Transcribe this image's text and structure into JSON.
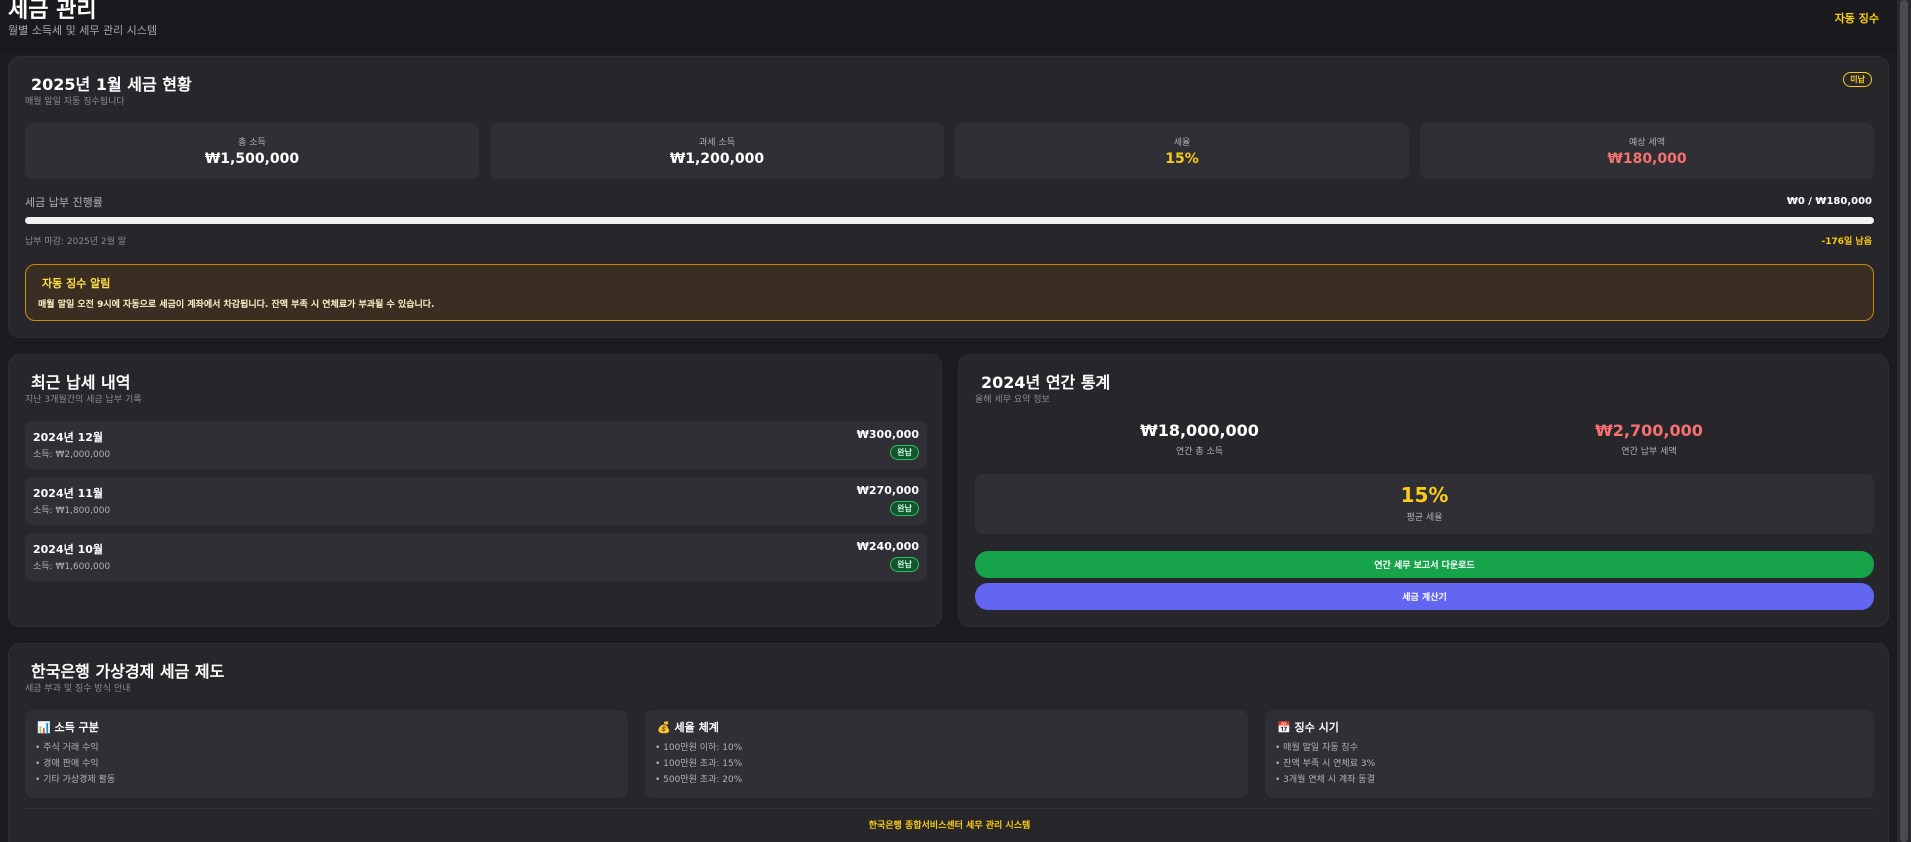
{
  "header": {
    "title": "세금 관리",
    "subtitle": "월별 소득세 및 세무 관리 시스템",
    "auto_link": "자동 징수"
  },
  "status": {
    "title": "2025년 1월 세금 현황",
    "subtitle": "매월 말일 자동 징수됩니다",
    "badge": "미납",
    "stats": [
      {
        "label": "총 소득",
        "value": "₩1,500,000",
        "color": "#ffffff"
      },
      {
        "label": "과세 소득",
        "value": "₩1,200,000",
        "color": "#ffffff"
      },
      {
        "label": "세율",
        "value": "15%",
        "color": "#facc15"
      },
      {
        "label": "예상 세액",
        "value": "₩180,000",
        "color": "#f87171"
      }
    ],
    "progress_label": "세금 납부 진행률",
    "progress_value": "₩0 / ₩180,000",
    "progress_fraction": 0,
    "deadline": "납부 마감: 2025년 2월 말",
    "overdue": "-176일 남음",
    "alert_title": "자동 징수 알림",
    "alert_text": "매월 말일 오전 9시에 자동으로 세금이 계좌에서 차감됩니다. 잔액 부족 시 연체료가 부과될 수 있습니다."
  },
  "recent": {
    "title": "최근 납세 내역",
    "subtitle": "지난 3개월간의 세금 납부 기록",
    "items": [
      {
        "month": "2024년 12월",
        "income": "소득: ₩2,000,000",
        "amount": "₩300,000",
        "status": "완납"
      },
      {
        "month": "2024년 11월",
        "income": "소득: ₩1,800,000",
        "amount": "₩270,000",
        "status": "완납"
      },
      {
        "month": "2024년 10월",
        "income": "소득: ₩1,600,000",
        "amount": "₩240,000",
        "status": "완납"
      }
    ]
  },
  "annual": {
    "title": "2024년 연간 통계",
    "subtitle": "올해 세무 요약 정보",
    "total_income_value": "₩18,000,000",
    "total_income_label": "연간 총 소득",
    "total_tax_value": "₩2,700,000",
    "total_tax_label": "연간 납부 세액",
    "avg_rate_value": "15%",
    "avg_rate_label": "평균 세율",
    "download_button": "연간 세무 보고서 다운로드",
    "calculator_button": "세금 계산기",
    "colors": {
      "income": "#ffffff",
      "tax": "#f87171",
      "rate": "#facc15"
    }
  },
  "system": {
    "title": "한국은행 가상경제 세금 제도",
    "subtitle": "세금 부과 및 징수 방식 안내",
    "boxes": [
      {
        "icon": "chart-icon",
        "glyph": "📊",
        "heading": "소득 구분",
        "items": [
          "• 주식 거래 수익",
          "• 경매 판매 수익",
          "• 기타 가상경제 활동"
        ]
      },
      {
        "icon": "money-bag-icon",
        "glyph": "💰",
        "heading": "세율 체계",
        "items": [
          "• 100만원 이하: 10%",
          "• 100만원 초과: 15%",
          "• 500만원 초과: 20%"
        ]
      },
      {
        "icon": "calendar-icon",
        "glyph": "📅",
        "heading": "징수 시기",
        "items": [
          "• 매월 말일 자동 징수",
          "• 잔액 부족 시 연체료 3%",
          "• 3개월 연체 시 계좌 동결"
        ]
      }
    ],
    "footer": "한국은행 종합서비스센터 세무 관리 시스템"
  }
}
